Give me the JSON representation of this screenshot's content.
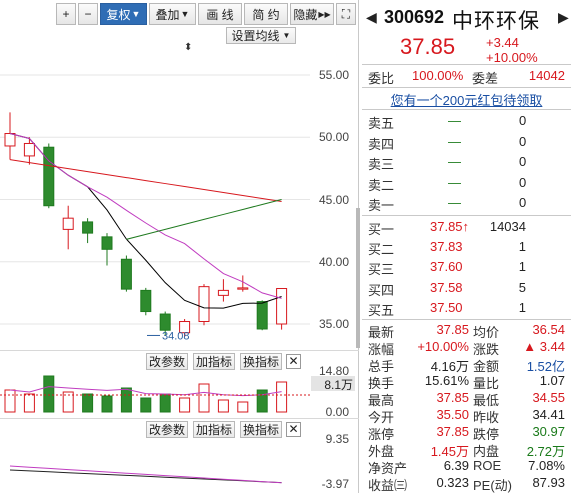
{
  "toolbar": {
    "plus": "+",
    "minus": "−",
    "fuquan": "复权",
    "diejia": "叠加",
    "huaxian": "画 线",
    "jianyue": "简 约",
    "yincang": "隐藏",
    "expand": "⛶"
  },
  "main_chart": {
    "settings_btn": "设置均线",
    "y_labels": [
      "55.00",
      "50.00",
      "45.00",
      "40.00",
      "35.00"
    ],
    "low_annotation": "34.08",
    "candles": [
      {
        "o": 49.3,
        "c": 50.3,
        "h": 52.0,
        "l": 48.2
      },
      {
        "o": 48.5,
        "c": 49.5,
        "h": 50.0,
        "l": 47.8
      },
      {
        "o": 49.2,
        "c": 44.5,
        "h": 49.5,
        "l": 44.3
      },
      {
        "o": 42.6,
        "c": 43.5,
        "h": 44.5,
        "l": 41.0
      },
      {
        "o": 43.2,
        "c": 42.3,
        "h": 43.5,
        "l": 41.5
      },
      {
        "o": 42.0,
        "c": 41.0,
        "h": 42.3,
        "l": 39.7
      },
      {
        "o": 40.2,
        "c": 37.8,
        "h": 40.5,
        "l": 37.6
      },
      {
        "o": 37.7,
        "c": 36.0,
        "h": 37.9,
        "l": 35.7
      },
      {
        "o": 35.8,
        "c": 34.5,
        "h": 36.0,
        "l": 34.1
      },
      {
        "o": 34.3,
        "c": 35.2,
        "h": 35.4,
        "l": 34.0
      },
      {
        "o": 35.2,
        "c": 38.0,
        "h": 38.2,
        "l": 34.9
      },
      {
        "o": 37.3,
        "c": 37.7,
        "h": 38.6,
        "l": 36.8
      },
      {
        "o": 37.8,
        "c": 37.9,
        "h": 38.9,
        "l": 37.6
      },
      {
        "o": 36.8,
        "c": 34.6,
        "h": 36.9,
        "l": 34.5
      },
      {
        "o": 35.0,
        "c": 37.85,
        "h": 37.85,
        "l": 34.55
      }
    ]
  },
  "vol_panel": {
    "btn1": "改参数",
    "btn2": "加指标",
    "btn3": "换指标",
    "close": "✕",
    "y_top": "14.80",
    "y_mid": "8.1万",
    "y_bot": "0.00"
  },
  "macd_panel": {
    "btn1": "改参数",
    "btn2": "加指标",
    "btn3": "换指标",
    "close": "✕",
    "y_top": "9.35",
    "y_bot": "-3.97"
  },
  "quote": {
    "code": "300692",
    "name": "中环环保",
    "price": "37.85",
    "change": "+3.44",
    "change_pct": "+10.00%",
    "weibi_label": "委比",
    "weibi": "100.00%",
    "weicha_label": "委差",
    "weicha": "14042",
    "promo_link": "您有一个200元红包待领取",
    "sells": [
      {
        "label": "卖五",
        "price": "—",
        "vol": "0"
      },
      {
        "label": "卖四",
        "price": "—",
        "vol": "0"
      },
      {
        "label": "卖三",
        "price": "—",
        "vol": "0"
      },
      {
        "label": "卖二",
        "price": "—",
        "vol": "0"
      },
      {
        "label": "卖一",
        "price": "—",
        "vol": "0"
      }
    ],
    "buys": [
      {
        "label": "买一",
        "price": "37.85↑",
        "vol": "14034"
      },
      {
        "label": "买二",
        "price": "37.83",
        "vol": "1"
      },
      {
        "label": "买三",
        "price": "37.60",
        "vol": "1"
      },
      {
        "label": "买四",
        "price": "37.58",
        "vol": "5"
      },
      {
        "label": "买五",
        "price": "37.50",
        "vol": "1"
      }
    ],
    "stats": [
      {
        "l1": "最新",
        "v1": "37.85",
        "c1": "red",
        "l2": "均价",
        "v2": "36.54",
        "c2": "red"
      },
      {
        "l1": "涨幅",
        "v1": "+10.00%",
        "c1": "red",
        "l2": "涨跌",
        "v2": "▲ 3.44",
        "c2": "red"
      },
      {
        "l1": "总手",
        "v1": "4.16万",
        "c1": "dark",
        "l2": "金额",
        "v2": "1.52亿",
        "c2": "blue"
      },
      {
        "l1": "换手",
        "v1": "15.61%",
        "c1": "dark",
        "l2": "量比",
        "v2": "1.07",
        "c2": "dark"
      },
      {
        "l1": "最高",
        "v1": "37.85",
        "c1": "red",
        "l2": "最低",
        "v2": "34.55",
        "c2": "red"
      },
      {
        "l1": "今开",
        "v1": "35.50",
        "c1": "red",
        "l2": "昨收",
        "v2": "34.41",
        "c2": "dark"
      },
      {
        "l1": "涨停",
        "v1": "37.85",
        "c1": "red",
        "l2": "跌停",
        "v2": "30.97",
        "c2": "green"
      },
      {
        "l1": "外盘",
        "v1": "1.45万",
        "c1": "red",
        "l2": "内盘",
        "v2": "2.72万",
        "c2": "green"
      },
      {
        "l1": "净资产",
        "v1": "6.39",
        "c1": "dark",
        "l2": "ROE",
        "v2": "7.08%",
        "c2": "dark"
      },
      {
        "l1": "收益㈢",
        "v1": "0.323",
        "c1": "dark",
        "l2": "PE(动)",
        "v2": "87.93",
        "c2": "dark"
      }
    ]
  }
}
